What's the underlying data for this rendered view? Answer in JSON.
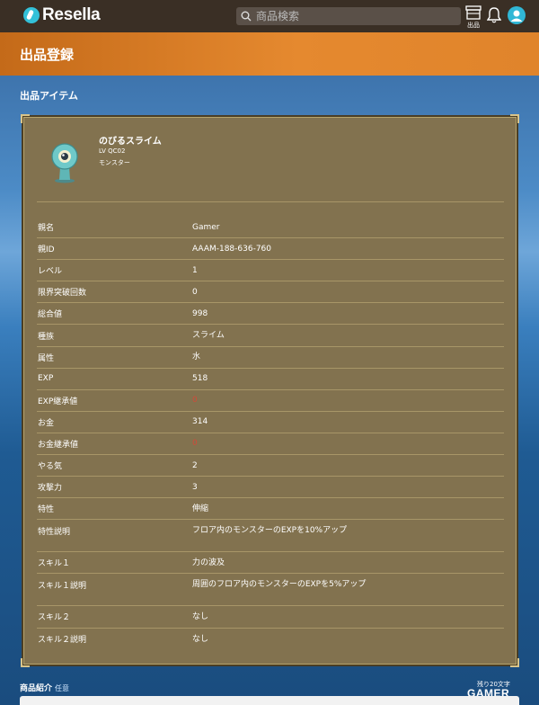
{
  "header": {
    "logo_text": "Resella",
    "search_placeholder": "商品検索",
    "listing_label": "出品",
    "icons": [
      "search-icon",
      "store-icon",
      "bell-icon",
      "user-icon"
    ]
  },
  "page": {
    "title": "出品登録",
    "section_label": "出品アイテム"
  },
  "item": {
    "name": "のびるスライム",
    "level_code": "LV QC02",
    "category": "モンスター"
  },
  "details": [
    {
      "key": "親名",
      "value": "Gamer"
    },
    {
      "key": "親ID",
      "value": "AAAM-188-636-760"
    },
    {
      "key": "レベル",
      "value": "1"
    },
    {
      "key": "限界突破回数",
      "value": "0"
    },
    {
      "key": "総合値",
      "value": "998"
    },
    {
      "key": "種族",
      "value": "スライム"
    },
    {
      "key": "属性",
      "value": "水"
    },
    {
      "key": "EXP",
      "value": "518"
    },
    {
      "key": "EXP継承値",
      "value": "0"
    },
    {
      "key": "お金",
      "value": "314"
    },
    {
      "key": "お金継承値",
      "value": "0"
    },
    {
      "key": "やる気",
      "value": "2"
    },
    {
      "key": "攻撃力",
      "value": "3"
    },
    {
      "key": "特性",
      "value": "伸縮"
    },
    {
      "key": "特性説明",
      "value": "フロア内のモンスターのEXPを10%アップ"
    },
    {
      "key": "スキル１",
      "value": "力の波及"
    },
    {
      "key": "スキル１説明",
      "value": "周囲のフロア内のモンスターのEXPを5%アップ"
    },
    {
      "key": "スキル２",
      "value": "なし"
    },
    {
      "key": "スキル２説明",
      "value": "なし"
    }
  ],
  "description": {
    "label": "商品紹介",
    "optional_tag": "任意",
    "char_count": "残り20文字"
  },
  "watermark": "GAMER",
  "colors": {
    "header_bg": "#3a2f25",
    "title_bar": "#e5892f",
    "card_bg": "#82724f",
    "zero_value": "#d14a3a"
  }
}
